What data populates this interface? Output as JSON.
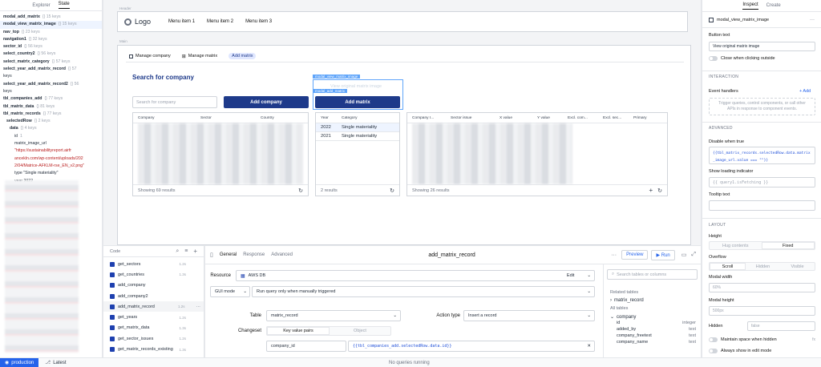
{
  "left_panel": {
    "tabs": [
      "Explorer",
      "State"
    ],
    "active_tab": "State",
    "state_lines": [
      {
        "name": "modal_add_matrix",
        "meta": "{} 15 keys",
        "bold": true
      },
      {
        "name": "modal_view_matrix_image",
        "meta": "{} 15 keys",
        "bold": true,
        "selected": true
      },
      {
        "name": "nav_top",
        "meta": "{} 23 keys",
        "bold": true
      },
      {
        "name": "navigation1",
        "meta": "{} 32 keys",
        "bold": true
      },
      {
        "name": "sector_id",
        "meta": "{} 56 keys",
        "bold": true
      },
      {
        "name": "select_country2",
        "meta": "{} 56 keys",
        "bold": true
      },
      {
        "name": "select_matrix_category",
        "meta": "{} 57 keys",
        "bold": true
      },
      {
        "name": "select_year_add_matrix_record",
        "meta": "{} 57",
        "bold": true
      },
      {
        "name": "keys",
        "meta": "",
        "bold": false
      },
      {
        "name": "select_year_add_matrix_record2",
        "meta": "{} 56",
        "bold": true
      },
      {
        "name": "keys",
        "meta": "",
        "bold": false
      },
      {
        "name": "tbl_companies_add",
        "meta": "{} 77 keys",
        "bold": true
      },
      {
        "name": "tbl_matrix_data",
        "meta": "{} 81 keys",
        "bold": true
      },
      {
        "name": "tbl_matrix_records",
        "meta": "{} 77 keys",
        "bold": true
      },
      {
        "name": "selectedRow",
        "meta": "{} 2 keys",
        "bold": true
      },
      {
        "name": "data",
        "meta": "{} 4 keys",
        "bold": true
      },
      {
        "name": "id",
        "meta": "1",
        "bold": false
      },
      {
        "name": "matrix_image_url",
        "meta": "",
        "bold": false
      },
      {
        "name": "\"https://sustainabilityreport.airfr",
        "meta": "",
        "bold": false,
        "str": true
      },
      {
        "name": "ancekln.com/wp-content/uploads/202",
        "meta": "",
        "bold": false,
        "str": true
      },
      {
        "name": "2/04/Matrice-AFKLM-rse_EN_v2.png\"",
        "meta": "",
        "bold": false,
        "str": true
      },
      {
        "name": "type \"Single materiality\"",
        "meta": "",
        "bold": false
      },
      {
        "name": "year 2022",
        "meta": "",
        "bold": false
      },
      {
        "name": "index 0",
        "meta": "",
        "bold": false
      }
    ]
  },
  "canvas": {
    "header_label": "Header",
    "main_label": "Main",
    "logo_text": "Logo",
    "menu_items": [
      "Menu item 1",
      "Menu item 2",
      "Menu item 3"
    ],
    "tabs": [
      "Manage company",
      "Manage matrix",
      "Add matrix"
    ],
    "section_title": "Search for company",
    "search_placeholder": "Search for company",
    "add_company_label": "Add company",
    "add_matrix_label": "Add matrix",
    "modal_view_tag": "modal_view_matrix_image",
    "modal_add_tag": "modal_add_matrix",
    "view_image_ghost": "View original matrix image",
    "company_table": {
      "headers": [
        "Company",
        "Sector",
        "Country"
      ],
      "footer": "Showing 69 results"
    },
    "year_table": {
      "headers": [
        "Year",
        "Category"
      ],
      "rows": [
        [
          "2022",
          "Single materiality"
        ],
        [
          "2021",
          "Single materiality"
        ]
      ],
      "footer": "2 results"
    },
    "matrix_table": {
      "headers": [
        "Company I...",
        "Sector issue",
        "X value",
        "Y value",
        "Excl. com...",
        "Excl. sec...",
        "Primary"
      ],
      "footer": "Showing 26 results"
    }
  },
  "code_panel": {
    "title": "Code",
    "queries": [
      {
        "name": "get_sectors",
        "time": "1.2s"
      },
      {
        "name": "get_countries",
        "time": "1.3s"
      },
      {
        "name": "add_company",
        "time": ""
      },
      {
        "name": "add_company2",
        "time": ""
      },
      {
        "name": "add_matrix_record",
        "time": "1.2s",
        "selected": true
      },
      {
        "name": "get_years",
        "time": "1.2s"
      },
      {
        "name": "get_matrix_data",
        "time": "1.3s"
      },
      {
        "name": "get_sector_issues",
        "time": "1.2s"
      },
      {
        "name": "get_matrix_records_existing",
        "time": "1.3s"
      }
    ]
  },
  "editor": {
    "tabs": [
      "General",
      "Response",
      "Advanced"
    ],
    "active_tab": "General",
    "query_name": "add_matrix_record",
    "preview_label": "Preview",
    "run_label": "Run",
    "resource_label": "Resource",
    "resource_value": "AWS DB",
    "edit_label": "Edit",
    "mode_value": "GUI mode",
    "trigger_value": "Run query only when manually triggered",
    "table_label": "Table",
    "table_value": "matrix_record",
    "action_label": "Action type",
    "action_value": "Insert a record",
    "changeset_label": "Changeset",
    "changeset_tabs": [
      "Key value pairs",
      "Object"
    ],
    "kv_key": "company_id",
    "kv_value": "{{tbl_companies_add.selectedRow.data.id}}",
    "search_tables_placeholder": "Search tables or columns",
    "related_tables_title": "Related tables",
    "related_table": "matrix_record",
    "all_tables_title": "All tables",
    "table_name": "company",
    "columns": [
      {
        "name": "id",
        "type": "integer"
      },
      {
        "name": "added_by",
        "type": "text"
      },
      {
        "name": "company_freetext",
        "type": "text"
      },
      {
        "name": "company_name",
        "type": "text"
      }
    ]
  },
  "inspector": {
    "tabs": [
      "Inspect",
      "Create"
    ],
    "component_name": "modal_view_matrix_image",
    "button_text_label": "Button text",
    "button_text_value": "View original matrix image",
    "close_outside_label": "Close when clicking outside",
    "interaction_title": "INTERACTION",
    "event_handlers_label": "Event handlers",
    "add_label": "+ Add",
    "event_handlers_hint": "Trigger queries, control components, or call other APIs in response to component events.",
    "advanced_title": "ADVANCED",
    "disable_label": "Disable when true",
    "disable_code": "{{tbl_matrix_records.selectedRow.data.matrix_image_url.value === \"\"}}",
    "loading_label": "Show loading indicator",
    "loading_placeholder": "{{ query1.isFetching }}",
    "tooltip_label": "Tooltip text",
    "layout_title": "LAYOUT",
    "height_label": "Height",
    "height_options": [
      "Hug contents",
      "Fixed"
    ],
    "overflow_label": "Overflow",
    "overflow_options": [
      "Scroll",
      "Hidden",
      "Visible"
    ],
    "modal_width_label": "Modal width",
    "modal_width_value": "60%",
    "modal_height_label": "Modal height",
    "modal_height_value": "500px",
    "hidden_label": "Hidden",
    "hidden_value": "false",
    "maintain_space_label": "Maintain space when hidden",
    "always_show_label": "Always show in edit mode"
  },
  "status_bar": {
    "environment": "production",
    "version": "Latest",
    "queries_status": "No queries running"
  },
  "colors": {
    "accent": "#1e3a8a",
    "link": "#2563eb",
    "code": "#1d4ed8"
  }
}
